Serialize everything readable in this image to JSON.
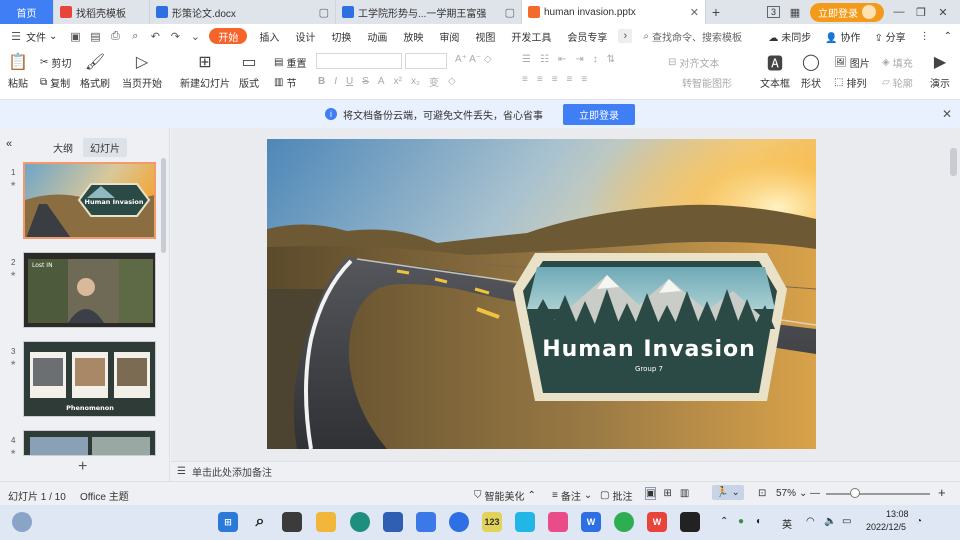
{
  "tabs": [
    {
      "label": "首页"
    },
    {
      "label": "找稻壳模板"
    },
    {
      "label": "形策论文.docx"
    },
    {
      "label": "工学院形势与...一学期王富强"
    },
    {
      "label": "human invasion.pptx"
    }
  ],
  "tab_right": {
    "badge": "3",
    "login": "立即登录"
  },
  "menu": {
    "file": "文件",
    "items": [
      "开始",
      "插入",
      "设计",
      "切换",
      "动画",
      "放映",
      "审阅",
      "视图",
      "开发工具",
      "会员专享"
    ],
    "search": "查找命令、搜索模板",
    "right": [
      "未同步",
      "协作",
      "分享"
    ]
  },
  "ribbon": {
    "paste": "粘贴",
    "cut": "剪切",
    "copy": "复制",
    "format_painter": "格式刷",
    "from_start": "当页开始",
    "new_slide": "新建幻灯片",
    "layout": "版式",
    "section": "节",
    "reset": "重置",
    "align_text": "对齐文本",
    "smartart": "转智能图形",
    "textbox": "文本框",
    "shape": "形状",
    "picture": "图片",
    "arrange": "排列",
    "fill": "填充",
    "outline": "轮廓",
    "present": "演示"
  },
  "infobar": {
    "text": "将文档备份云端，可避免文件丢失，省心省事",
    "button": "立即登录"
  },
  "panel": {
    "outline_tab": "大纲",
    "slides_tab": "幻灯片"
  },
  "thumbnails": [
    {
      "num": "1",
      "caption": "Human Invasion"
    },
    {
      "num": "2",
      "caption": "Lost IN"
    },
    {
      "num": "3",
      "caption": "Phenomenon"
    },
    {
      "num": "4",
      "caption": ""
    }
  ],
  "slide": {
    "title": "Human Invasion",
    "subtitle": "Group 7"
  },
  "notes": "单击此处添加备注",
  "status": {
    "slide_info": "幻灯片 1 / 10",
    "theme": "Office 主题",
    "beautify": "智能美化",
    "notes": "备注",
    "comments": "批注",
    "zoom": "57%",
    "zoom_fraction": 0.57
  },
  "taskbar": {
    "lang": "英",
    "time": "13:08",
    "date": "2022/12/5"
  },
  "colors": {
    "accent": "#3f7ef4",
    "start_tab": "#f4642b",
    "login": "#f49a1a",
    "badge_fill": "#2c4a45",
    "badge_border": "#e9e1c8"
  }
}
